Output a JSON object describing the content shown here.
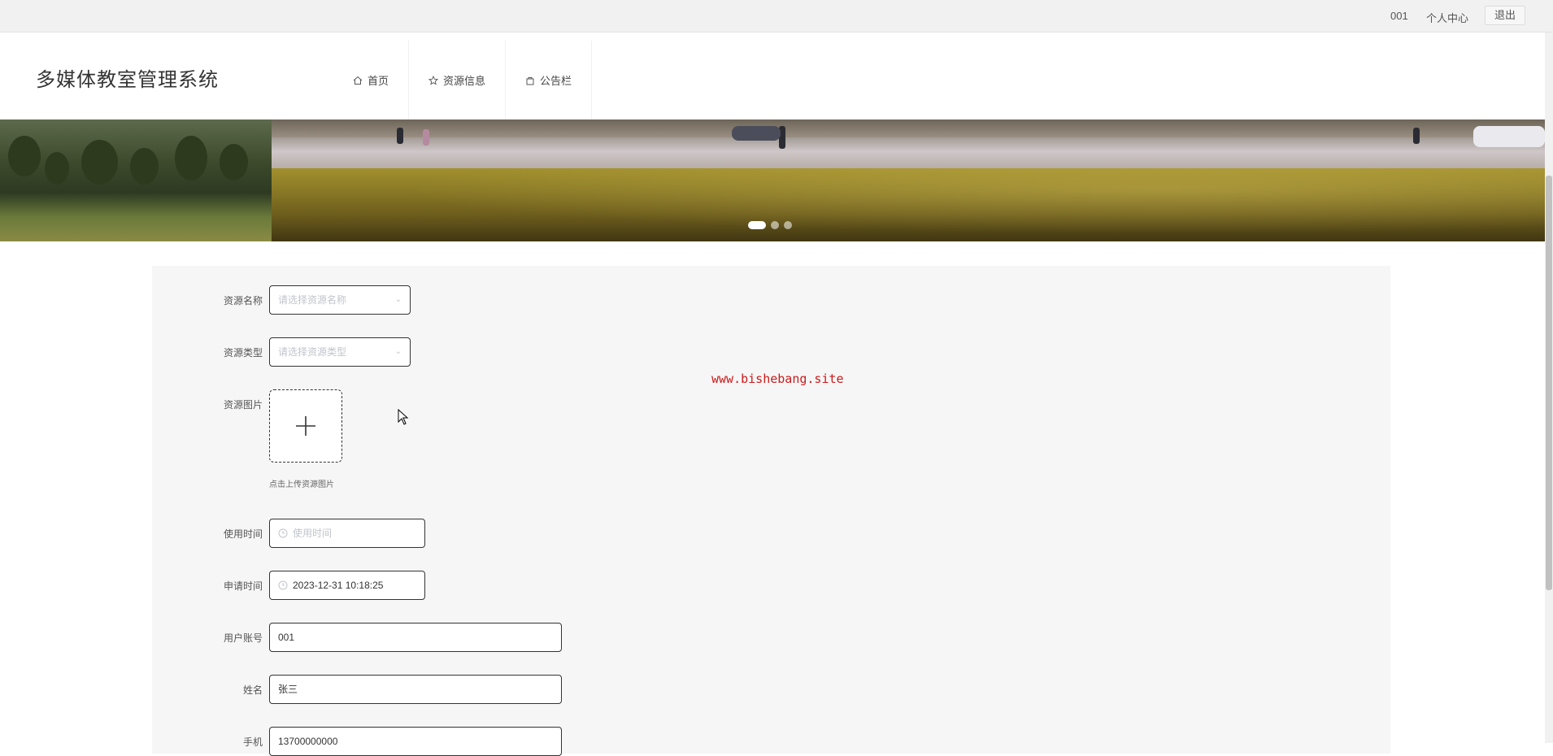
{
  "topbar": {
    "username": "001",
    "personal_center": "个人中心",
    "logout": "退出"
  },
  "header": {
    "brand": "多媒体教室管理系统",
    "nav": [
      {
        "label": "首页",
        "icon": "home-icon"
      },
      {
        "label": "资源信息",
        "icon": "star-icon"
      },
      {
        "label": "公告栏",
        "icon": "bag-icon"
      }
    ]
  },
  "banner": {
    "slides_count": 3,
    "active_slide": 1
  },
  "form": {
    "resource_name": {
      "label": "资源名称",
      "placeholder": "请选择资源名称"
    },
    "resource_type": {
      "label": "资源类型",
      "placeholder": "请选择资源类型"
    },
    "resource_image": {
      "label": "资源图片",
      "tip": "点击上传资源图片"
    },
    "use_time": {
      "label": "使用时间",
      "placeholder": "使用时间"
    },
    "apply_time": {
      "label": "申请时间",
      "value": "2023-12-31 10:18:25"
    },
    "user_account": {
      "label": "用户账号",
      "value": "001"
    },
    "name": {
      "label": "姓名",
      "value": "张三"
    },
    "phone": {
      "label": "手机",
      "value": "13700000000"
    }
  },
  "watermark": "www.bishebang.site",
  "colors": {
    "watermark": "#cc1a1a",
    "form_bg": "#f6f6f6",
    "topbar_bg": "#f1f1f1"
  }
}
